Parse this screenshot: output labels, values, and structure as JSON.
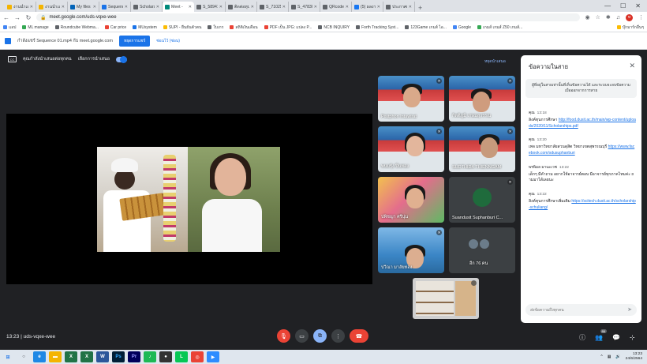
{
  "browser": {
    "tabs": [
      {
        "label": "งานนำเสนอ",
        "color": "#f4b400"
      },
      {
        "label": "งานนำเสนอ",
        "color": "#f4b400"
      },
      {
        "label": "My files - O",
        "color": "#0364b8"
      },
      {
        "label": "Sequence",
        "color": "#1a73e8"
      },
      {
        "label": "Scholarship",
        "color": "#5f6368"
      },
      {
        "label": "Meet -",
        "color": "#00897b",
        "active": true
      },
      {
        "label": "S_5894150",
        "color": "#5f6368"
      },
      {
        "label": "ติดต่อทุน",
        "color": "#5f6368"
      },
      {
        "label": "S_7102572",
        "color": "#5f6368"
      },
      {
        "label": "S_4783027",
        "color": "#5f6368"
      },
      {
        "label": "QRcodes",
        "color": "#5f6368"
      },
      {
        "label": "(5) ผลงาน",
        "color": "#1877f2"
      },
      {
        "label": "ประกาศผล",
        "color": "#5f6368"
      }
    ],
    "new_tab": "+",
    "url": "meet.google.com/uds-vqxe-wee",
    "profile_initial": "ห"
  },
  "bookmarks": [
    {
      "label": "แอป",
      "color": "#4285f4"
    },
    {
      "label": "ML manage",
      "color": "#34a853"
    },
    {
      "label": "Roundcube Webma...",
      "color": "#5f6368"
    },
    {
      "label": "Car price",
      "color": "#ea4335"
    },
    {
      "label": "MUsystem",
      "color": "#1a73e8"
    },
    {
      "label": "SUPI - ยืนยันตัวตน",
      "color": "#fbbc04"
    },
    {
      "label": "ใบเกร",
      "color": "#5f6368"
    },
    {
      "label": "สถิติเงินเดือน",
      "color": "#ea4335"
    },
    {
      "label": "PDF เป็น JPG: แปลง P...",
      "color": "#ea4335"
    },
    {
      "label": "NCB INQUIRY",
      "color": "#5f6368"
    },
    {
      "label": "Forth Tracking Syst...",
      "color": "#5f6368"
    },
    {
      "label": "123Game เกมส์ ไอ...",
      "color": "#5f6368"
    },
    {
      "label": "Google",
      "color": "#4285f4"
    },
    {
      "label": "เกมส์ เกมส์ Z50 เกมส์...",
      "color": "#34a853"
    }
  ],
  "bookmarks_other": "บุ๊กมาร์กอื่นๆ",
  "notice": {
    "text": "กำลังแชร์ Sequence 01.mp4 กับ meet.google.com",
    "stop_button": "หยุดการแชร์",
    "hide_link": "ซ่อนไว้ (ซ่อน)"
  },
  "captions": {
    "cc_label": "CC",
    "show_label": "คุณกำลังนำเสนอต่อทุกคน",
    "other_label": "เลือกการนำเสนอ",
    "pin_label": "หยุดนำเสนอ"
  },
  "tiles": [
    {
      "name": "Pisitphon Intawirat",
      "muted": true
    },
    {
      "name": "กิตติภูมิ เกษมสุวรรณ",
      "muted": true
    },
    {
      "name": "พนมรุ้ง ปิ่นทอง",
      "muted": true
    },
    {
      "name": "SUDTHIDA THIENNGAM",
      "muted": true
    },
    {
      "name": "ปพิชญา ศรีนุ่น",
      "muted": false
    },
    {
      "name": "Suandusit Suphanburi C...",
      "muted": true
    },
    {
      "name": "ปวีณา มาลัยทอง",
      "muted": true
    },
    {
      "name": "อีก 76 คน",
      "muted": false
    }
  ],
  "chat": {
    "title": "ข้อความในสาย",
    "info": "ผู้ที่อยู่ในสายเท่านั้นที่เห็นข้อความได้ และระบบจะลบข้อความเมื่อออกจากการสาย",
    "messages": [
      {
        "who": "คุณ",
        "time": "13:18",
        "text": "ลิงค์ทุนการศึกษา ",
        "link": "http://food.dusit.ac.th/main/wp-content/uploads/2020/11/Scholarships.pdf"
      },
      {
        "who": "คุณ",
        "time": "13:20",
        "text": "เพจ มหาวิทยาลัยสวนดุสิต วิทยาเขตสุพรรณบุรี ",
        "link": "https://www.facebook.com/sdusuphanburi"
      },
      {
        "who": "พรพิมล มาฆะเวช",
        "time": "13:22",
        "text": "เด็กๆ มีคำถาม อยากให้อาจารย์ตอบ มีอาจารย์ทุกภาคไหมค่ะ ถามมาได้เลยนะ",
        "link": ""
      },
      {
        "who": "คุณ",
        "time": "13:22",
        "text": "ลิงค์ทุนการศึกษาเพิ่มเติม ",
        "link": "https://scitech.dusit.ac.th/scholarship-schuliang/"
      }
    ],
    "input_placeholder": "ส่งข้อความถึงทุกคน"
  },
  "meeting": {
    "time": "13:23",
    "code": "uds-vqxe-wee",
    "participant_count": "86"
  },
  "taskbar": {
    "time": "13:23",
    "date": "24/6/2564"
  }
}
